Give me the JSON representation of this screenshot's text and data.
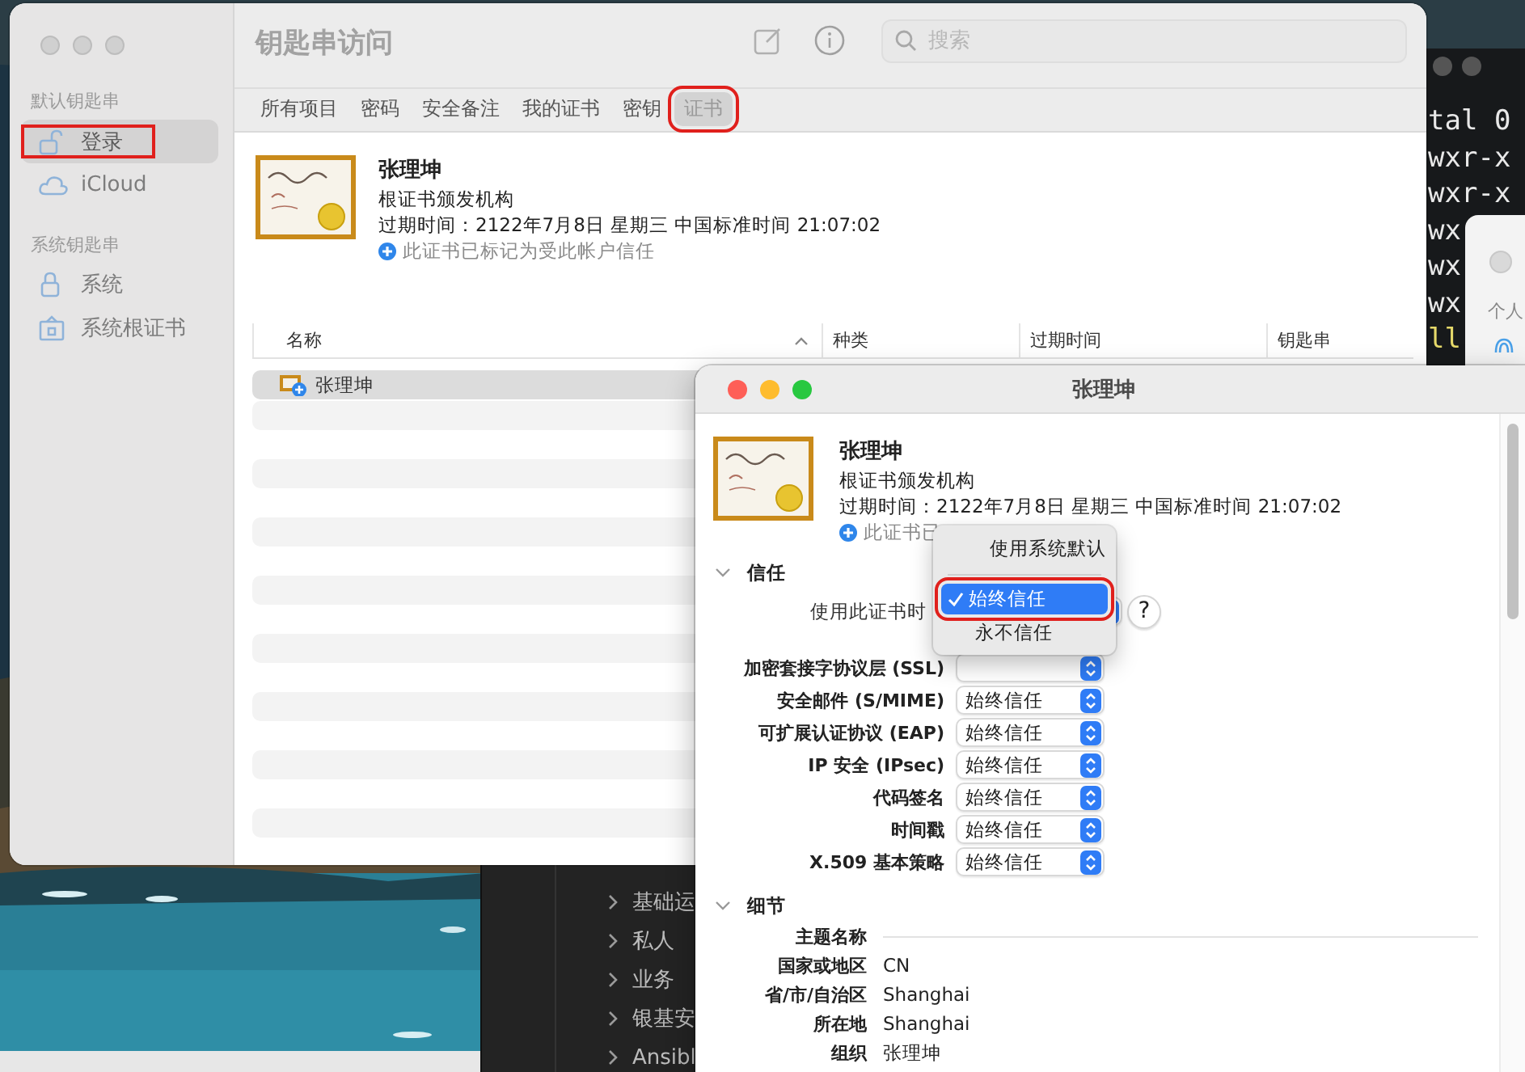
{
  "keychain_window": {
    "title": "钥匙串访问",
    "search": {
      "placeholder": "搜索"
    },
    "sidebar": [
      {
        "header": "默认钥匙串",
        "items": [
          {
            "label": "登录",
            "kind": "lock-open",
            "selected": true,
            "annotated": true
          },
          {
            "label": "iCloud",
            "kind": "cloud",
            "selected": false,
            "annotated": false
          }
        ]
      },
      {
        "header": "系统钥匙串",
        "items": [
          {
            "label": "系统",
            "kind": "lock",
            "selected": false,
            "annotated": false
          },
          {
            "label": "系统根证书",
            "kind": "vault",
            "selected": false,
            "annotated": false
          }
        ]
      }
    ],
    "tabs": [
      {
        "label": "所有项目",
        "selected": false,
        "annotated": false
      },
      {
        "label": "密码",
        "selected": false,
        "annotated": false
      },
      {
        "label": "安全备注",
        "selected": false,
        "annotated": false
      },
      {
        "label": "我的证书",
        "selected": false,
        "annotated": false
      },
      {
        "label": "密钥",
        "selected": false,
        "annotated": false
      },
      {
        "label": "证书",
        "selected": true,
        "annotated": true
      }
    ],
    "certificate": {
      "name": "张理坤",
      "issuer_type": "根证书颁发机构",
      "expiry": "过期时间：2122年7月8日 星期三 中国标准时间 21:07:02",
      "trust_note": "此证书已标记为受此帐户信任"
    },
    "table": {
      "columns": [
        {
          "label": "名称",
          "sorted": true
        },
        {
          "label": "种类",
          "sorted": false
        },
        {
          "label": "过期时间",
          "sorted": false
        },
        {
          "label": "钥匙串",
          "sorted": false
        }
      ],
      "rows": [
        {
          "name": "张理坤",
          "selected": true
        }
      ]
    }
  },
  "dialog": {
    "title": "张理坤",
    "certificate": {
      "name": "张理坤",
      "issuer_type": "根证书颁发机构",
      "expiry": "过期时间：2122年7月8日 星期三 中国标准时间 21:07:02",
      "trust_note": "此证书已"
    },
    "trust": {
      "heading": "信任",
      "expanded": true,
      "when_using_label": "使用此证书时",
      "help": "?",
      "menu": [
        [
          {
            "label": "使用系统默认",
            "selected": false,
            "annotated": false
          }
        ],
        [
          {
            "label": "始终信任",
            "selected": true,
            "annotated": true
          },
          {
            "label": "永不信任",
            "selected": false,
            "annotated": false
          }
        ]
      ],
      "policies": [
        {
          "label": "加密套接字协议层 (SSL)"
        },
        {
          "label": "安全邮件 (S/MIME)",
          "value": "始终信任"
        },
        {
          "label": "可扩展认证协议 (EAP)",
          "value": "始终信任"
        },
        {
          "label": "IP 安全 (IPsec)",
          "value": "始终信任"
        },
        {
          "label": "代码签名",
          "value": "始终信任"
        },
        {
          "label": "时间戳",
          "value": "始终信任"
        },
        {
          "label": "X.509 基本策略",
          "value": "始终信任"
        }
      ]
    },
    "details": {
      "heading": "细节",
      "expanded": true,
      "rows": [
        {
          "label": "主题名称"
        },
        {
          "label": "国家或地区",
          "value": "CN"
        },
        {
          "label": "省/市/自治区",
          "value": "Shanghai"
        },
        {
          "label": "所在地",
          "value": "Shanghai"
        },
        {
          "label": "组织",
          "value": "张理坤"
        }
      ]
    }
  },
  "terminal": {
    "lines": [
      {
        "text": "tal 0",
        "color": "#e8e8e8"
      },
      {
        "text": "wxr-x",
        "color": "#e8e8e8"
      },
      {
        "text": "wxr-x",
        "color": "#e8e8e8"
      },
      {
        "text": "wx",
        "color": "#e8e8e8"
      },
      {
        "text": "wx",
        "color": "#e8e8e8"
      },
      {
        "text": "wx",
        "color": "#e8e8e8"
      },
      {
        "text": "ll",
        "color": "#e6d96a"
      }
    ]
  },
  "small_window": {
    "label": "个人"
  },
  "dark_app": {
    "items": [
      "基础运",
      "私人",
      "业务",
      "银基安",
      "Ansibl"
    ]
  }
}
